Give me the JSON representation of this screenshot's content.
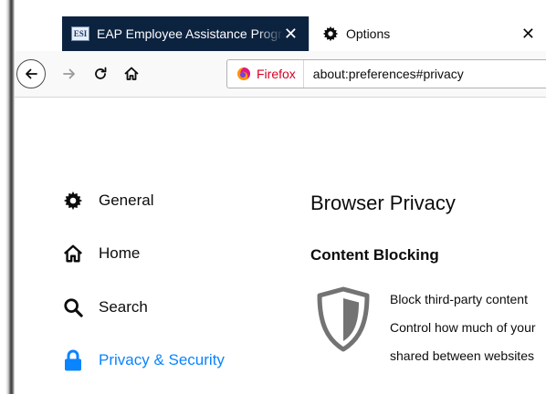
{
  "tabs": [
    {
      "title": "EAP Employee Assistance Program",
      "favicon": "ESI",
      "active": false
    },
    {
      "title": "Options",
      "active": true
    }
  ],
  "tab_close_glyph": "✕",
  "urlbar": {
    "identity_label": "Firefox",
    "url": "about:preferences#privacy"
  },
  "sidebar": {
    "items": [
      {
        "label": "General",
        "icon": "gear-icon"
      },
      {
        "label": "Home",
        "icon": "home-icon"
      },
      {
        "label": "Search",
        "icon": "search-icon"
      },
      {
        "label": "Privacy & Security",
        "icon": "lock-icon",
        "selected": true
      }
    ]
  },
  "main": {
    "title": "Browser Privacy",
    "section_title": "Content Blocking",
    "description_lines": [
      "Block third-party content",
      "Control how much of your",
      "shared between websites"
    ]
  },
  "colors": {
    "accent": "#0a84ff",
    "inactive_tab_bg": "#0c2340",
    "firefox_red": "#d70022"
  }
}
